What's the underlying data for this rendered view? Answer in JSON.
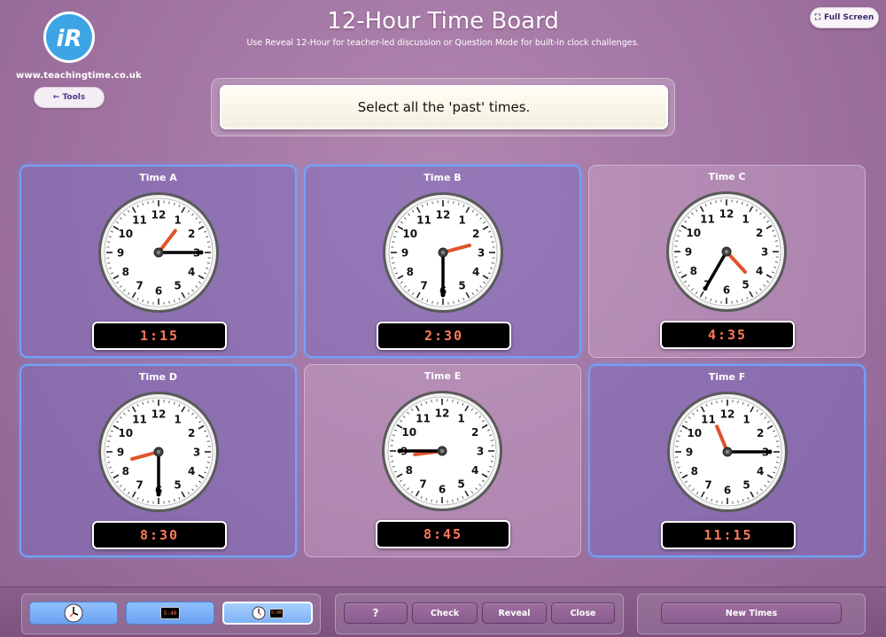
{
  "header": {
    "title": "12-Hour Time Board",
    "subtitle": "Use Reveal 12-Hour for teacher-led discussion or Question Mode for built-in clock challenges.",
    "site_url": "www.teachingtime.co.uk",
    "logo_text": "iR",
    "tools_label": "← Tools",
    "fullscreen_label": "Full Screen",
    "fullscreen_icon": "⛶"
  },
  "prompt": "Select all the 'past' times.",
  "cards": [
    {
      "label": "Time A",
      "time": "1:15",
      "hour": 1,
      "minute": 15,
      "selected": true
    },
    {
      "label": "Time B",
      "time": "2:30",
      "hour": 2,
      "minute": 30,
      "selected": true
    },
    {
      "label": "Time C",
      "time": "4:35",
      "hour": 4,
      "minute": 35,
      "selected": false
    },
    {
      "label": "Time D",
      "time": "8:30",
      "hour": 8,
      "minute": 30,
      "selected": true
    },
    {
      "label": "Time E",
      "time": "8:45",
      "hour": 8,
      "minute": 45,
      "selected": false
    },
    {
      "label": "Time F",
      "time": "11:15",
      "hour": 11,
      "minute": 15,
      "selected": true
    }
  ],
  "toolbar": {
    "mode_digital_text": "5:40",
    "question_label": "?",
    "check_label": "Check",
    "reveal_label": "Reveal",
    "close_label": "Close",
    "new_times_label": "New Times"
  },
  "colors": {
    "accent_blue": "#6fa4ff",
    "digital_text": "#ff7a5a",
    "hour_hand": "#e0532a"
  }
}
